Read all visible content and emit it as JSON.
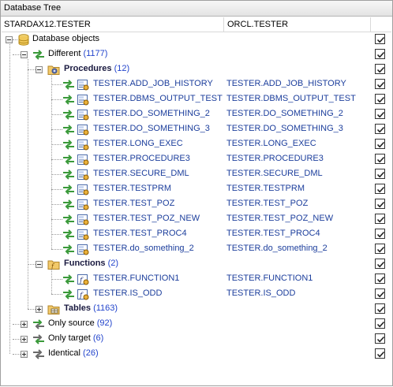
{
  "window": {
    "title": "Database Tree"
  },
  "columns": {
    "source": "STARDAX12.TESTER",
    "target": "ORCL.TESTER"
  },
  "root": {
    "label": "Database objects",
    "checked": true
  },
  "different": {
    "label": "Different",
    "count": "(1177)",
    "checked": true,
    "procedures": {
      "label": "Procedures",
      "count": "(12)",
      "checked": true,
      "items": [
        {
          "left": "TESTER.ADD_JOB_HISTORY",
          "right": "TESTER.ADD_JOB_HISTORY",
          "checked": true
        },
        {
          "left": "TESTER.DBMS_OUTPUT_TEST",
          "right": "TESTER.DBMS_OUTPUT_TEST",
          "checked": true
        },
        {
          "left": "TESTER.DO_SOMETHING_2",
          "right": "TESTER.DO_SOMETHING_2",
          "checked": true
        },
        {
          "left": "TESTER.DO_SOMETHING_3",
          "right": "TESTER.DO_SOMETHING_3",
          "checked": true
        },
        {
          "left": "TESTER.LONG_EXEC",
          "right": "TESTER.LONG_EXEC",
          "checked": true
        },
        {
          "left": "TESTER.PROCEDURE3",
          "right": "TESTER.PROCEDURE3",
          "checked": true
        },
        {
          "left": "TESTER.SECURE_DML",
          "right": "TESTER.SECURE_DML",
          "checked": true
        },
        {
          "left": "TESTER.TESTPRM",
          "right": "TESTER.TESTPRM",
          "checked": true
        },
        {
          "left": "TESTER.TEST_POZ",
          "right": "TESTER.TEST_POZ",
          "checked": true
        },
        {
          "left": "TESTER.TEST_POZ_NEW",
          "right": "TESTER.TEST_POZ_NEW",
          "checked": true
        },
        {
          "left": "TESTER.TEST_PROC4",
          "right": "TESTER.TEST_PROC4",
          "checked": true
        },
        {
          "left": "TESTER.do_something_2",
          "right": "TESTER.do_something_2",
          "checked": true
        }
      ]
    },
    "functions": {
      "label": "Functions",
      "count": "(2)",
      "checked": true,
      "items": [
        {
          "left": "TESTER.FUNCTION1",
          "right": "TESTER.FUNCTION1",
          "checked": true
        },
        {
          "left": "TESTER.IS_ODD",
          "right": "TESTER.IS_ODD",
          "checked": true
        }
      ]
    },
    "tables": {
      "label": "Tables",
      "count": "(1163)",
      "checked": true
    }
  },
  "only_source": {
    "label": "Only source",
    "count": "(92)",
    "checked": true
  },
  "only_target": {
    "label": "Only target",
    "count": "(6)",
    "checked": true
  },
  "identical": {
    "label": "Identical",
    "count": "(26)",
    "checked": true
  },
  "colors": {
    "arrow_green": "#3a9a3a",
    "arrow_gray": "#6a6a6a",
    "link_blue": "#1c3e9c",
    "count_blue": "#2244cc"
  }
}
